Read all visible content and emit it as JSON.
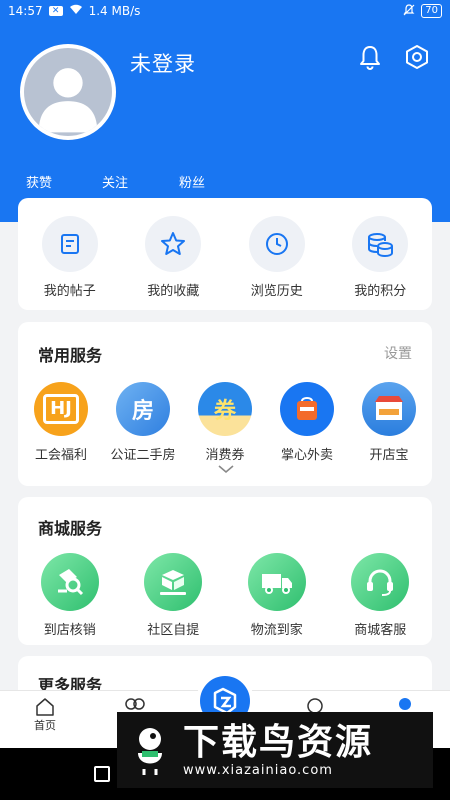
{
  "status_bar": {
    "time": "14:57",
    "speed": "1.4 MB/s",
    "battery": "70"
  },
  "header": {
    "login_text": "未登录",
    "stats": {
      "likes": "获赞",
      "following": "关注",
      "fans": "粉丝"
    }
  },
  "quick_actions": [
    {
      "label": "我的帖子",
      "icon": "post-icon"
    },
    {
      "label": "我的收藏",
      "icon": "star-icon"
    },
    {
      "label": "浏览历史",
      "icon": "clock-icon"
    },
    {
      "label": "我的积分",
      "icon": "coins-icon"
    }
  ],
  "common_services": {
    "title": "常用服务",
    "settings_label": "设置",
    "items": [
      {
        "label": "工会福利",
        "badge": "HJ",
        "color": "#f7a21b"
      },
      {
        "label": "公证二手房",
        "badge": "房",
        "color": "#4a93e8"
      },
      {
        "label": "消费券",
        "badge": "券",
        "color": "#2b89e8"
      },
      {
        "label": "掌心外卖",
        "badge": "",
        "color": "#1976f2"
      },
      {
        "label": "开店宝",
        "badge": "",
        "color": "#3d8de8"
      }
    ]
  },
  "mall_services": {
    "title": "商城服务",
    "items": [
      {
        "label": "到店核销",
        "icon": "verify-icon"
      },
      {
        "label": "社区自提",
        "icon": "package-icon"
      },
      {
        "label": "物流到家",
        "icon": "truck-icon"
      },
      {
        "label": "商城客服",
        "icon": "headset-icon"
      }
    ]
  },
  "more_services": {
    "title": "更多服务"
  },
  "tabbar": {
    "home": "首页"
  },
  "watermark": {
    "title": "下载鸟资源",
    "url": "www.xiazainiao.com"
  },
  "colors": {
    "primary": "#1976f2",
    "mall_green": "#2fbf6f",
    "background": "#f2f3f5"
  }
}
